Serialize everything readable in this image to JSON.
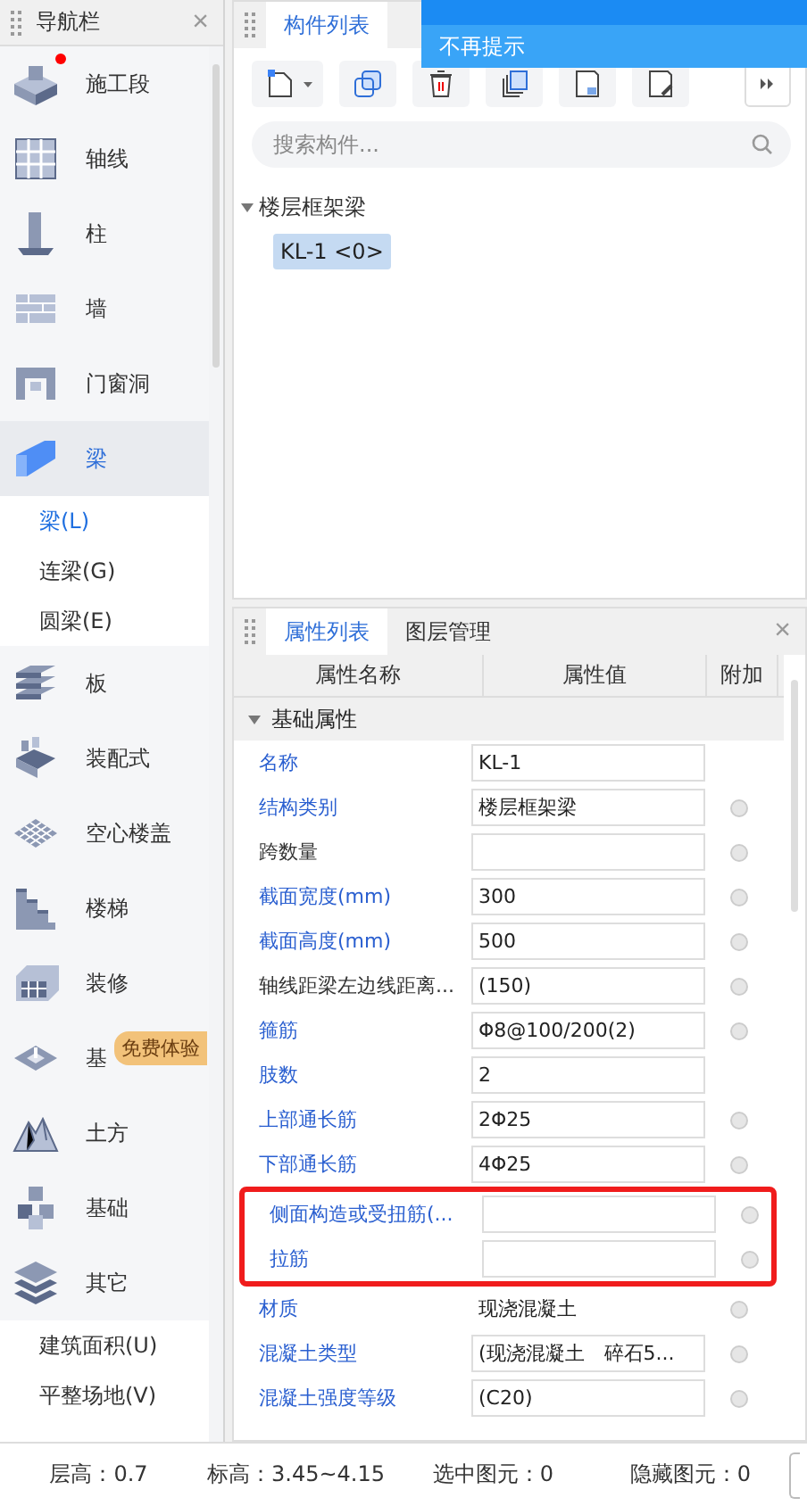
{
  "nav": {
    "title": "导航栏",
    "close": "×",
    "items": [
      {
        "label": "施工段",
        "selected": false,
        "new_dot": true
      },
      {
        "label": "轴线",
        "selected": false
      },
      {
        "label": "柱",
        "selected": false
      },
      {
        "label": "墙",
        "selected": false
      },
      {
        "label": "门窗洞",
        "selected": false
      },
      {
        "label": "梁",
        "selected": true,
        "children": [
          {
            "label": "梁(L)",
            "selected": true
          },
          {
            "label": "连梁(G)",
            "selected": false
          },
          {
            "label": "圆梁(E)",
            "selected": false
          }
        ]
      },
      {
        "label": "板",
        "selected": false
      },
      {
        "label": "装配式",
        "selected": false
      },
      {
        "label": "空心楼盖",
        "selected": false
      },
      {
        "label": "楼梯",
        "selected": false
      },
      {
        "label": "装修",
        "selected": false
      },
      {
        "label": "基",
        "selected": false
      },
      {
        "label": "土方",
        "selected": false
      },
      {
        "label": "基础",
        "selected": false
      },
      {
        "label": "其它",
        "selected": false,
        "children": [
          {
            "label": "建筑面积(U)",
            "selected": false
          },
          {
            "label": "平整场地(V)",
            "selected": false
          }
        ]
      }
    ],
    "badge": "免费体验"
  },
  "component_panel": {
    "tabs": [
      {
        "label": "构件列表",
        "selected": true
      }
    ],
    "search": {
      "placeholder": "搜索构件..."
    },
    "tree": [
      {
        "label": "楼层框架梁",
        "expanded": true,
        "children": [
          {
            "label": "KL-1 <0>",
            "selected": true
          }
        ]
      }
    ]
  },
  "popup": {
    "option": "不再提示"
  },
  "property_panel": {
    "tabs": [
      {
        "label": "属性列表",
        "selected": true
      },
      {
        "label": "图层管理",
        "selected": false
      }
    ],
    "close": "×",
    "columns": [
      "属性名称",
      "属性值",
      "附加"
    ],
    "group": {
      "label": "基础属性",
      "expanded": true
    },
    "rows": [
      {
        "name": "名称",
        "value": "KL-1",
        "common": true,
        "marked": false,
        "boxed": true
      },
      {
        "name": "结构类别",
        "value": "楼层框架梁",
        "common": true,
        "marked": false,
        "boxed": true,
        "checked": false
      },
      {
        "name": "跨数量",
        "value": "",
        "common": false,
        "marked": false,
        "boxed": true,
        "checked": false
      },
      {
        "name": "截面宽度(mm)",
        "value": "300",
        "common": true,
        "marked": false,
        "boxed": true,
        "checked": false
      },
      {
        "name": "截面高度(mm)",
        "value": "500",
        "common": true,
        "marked": false,
        "boxed": true,
        "checked": false
      },
      {
        "name": "轴线距梁左边线距离...",
        "value": "(150)",
        "common": false,
        "marked": false,
        "boxed": true,
        "checked": false
      },
      {
        "name": "箍筋",
        "value": "Φ8@100/200(2)",
        "common": true,
        "marked": false,
        "boxed": true,
        "checked": false
      },
      {
        "name": "肢数",
        "value": "2",
        "common": true,
        "marked": false,
        "boxed": true
      },
      {
        "name": "上部通长筋",
        "value": "2Φ25",
        "common": true,
        "marked": false,
        "boxed": true,
        "checked": false
      },
      {
        "name": "下部通长筋",
        "value": "4Φ25",
        "common": true,
        "marked": false,
        "boxed": true,
        "checked": false
      },
      {
        "name": "侧面构造或受扭筋(...",
        "value": "",
        "common": true,
        "marked": true,
        "boxed": true,
        "checked": false
      },
      {
        "name": "拉筋",
        "value": "",
        "common": true,
        "marked": true,
        "boxed": true,
        "checked": false
      },
      {
        "name": "材质",
        "value": "现浇混凝土",
        "common": true,
        "marked": false,
        "boxed": false,
        "checked": false
      },
      {
        "name": "混凝土类型",
        "value": "(现浇混凝土　碎石5...",
        "common": true,
        "marked": false,
        "boxed": true,
        "checked": false
      },
      {
        "name": "混凝土强度等级",
        "value": "(C20)",
        "common": true,
        "marked": false,
        "boxed": true,
        "checked": false
      }
    ]
  },
  "status_bar": [
    "层高：0.7",
    "标高：3.45~4.15",
    "选中图元：0",
    "隐藏图元：0"
  ]
}
